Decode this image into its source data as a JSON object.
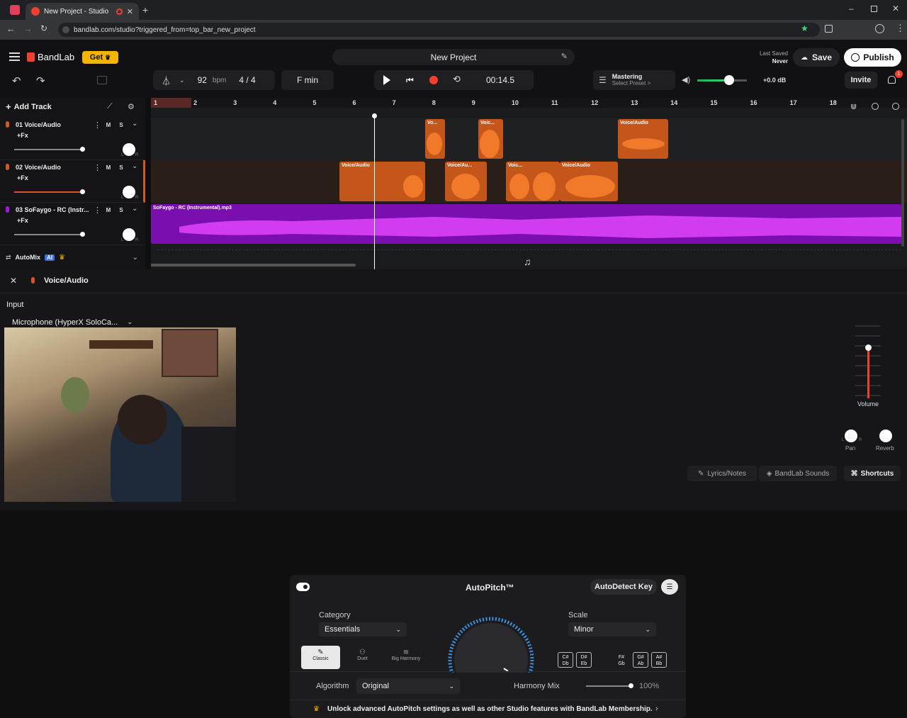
{
  "browser": {
    "tab_title": "New Project - Studio",
    "url": "bandlab.com/studio?triggered_from=top_bar_new_project"
  },
  "app": {
    "logo": "BandLab",
    "get_label": "Get",
    "project_title": "New Project",
    "last_saved_label": "Last Saved",
    "last_saved_value": "Never",
    "save_label": "Save",
    "publish_label": "Publish",
    "invite_label": "Invite",
    "notification_count": "1"
  },
  "transport": {
    "bpm": "92",
    "bpm_unit": "bpm",
    "time_sig": "4 / 4",
    "key": "F min",
    "time": "00:14.5",
    "mastering_label": "Mastering",
    "mastering_sub": "Select Preset >",
    "volume_db": "+0.0 dB"
  },
  "track_panel": {
    "add_track": "Add Track",
    "automix": "AutoMix",
    "ai_badge": "AI"
  },
  "tracks": [
    {
      "name": "01  Voice/Audio",
      "fx": "+Fx",
      "m": "M",
      "s": "S",
      "pan_l": "L",
      "pan_r": "R"
    },
    {
      "name": "02  Voice/Audio",
      "fx": "+Fx",
      "m": "M",
      "s": "S",
      "pan_l": "L",
      "pan_r": "R"
    },
    {
      "name": "03  SoFaygo - RC (Instr...",
      "fx": "+Fx",
      "m": "M",
      "s": "S",
      "pan_l": "L",
      "pan_r": "R"
    }
  ],
  "ruler": [
    "1",
    "2",
    "3",
    "4",
    "5",
    "6",
    "7",
    "8",
    "9",
    "10",
    "11",
    "12",
    "13",
    "14",
    "15",
    "16",
    "17",
    "18"
  ],
  "clips": {
    "c1a": "Vo...",
    "c1b": "Voic...",
    "c1c": "Voice/Audio",
    "c2a": "Voice/Audio",
    "c2b": "Voice/Au...",
    "c2c": "Voic...",
    "c2d": "Voice/Audio",
    "c3": "SoFaygo - RC (Instrumental).mp3"
  },
  "editor": {
    "title": "Voice/Audio",
    "input_label": "Input",
    "input_value": "Microphone (HyperX SoloCa...",
    "autopitch_title": "AutoPitch™",
    "autodetect": "AutoDetect Key",
    "category_label": "Category",
    "category_value": "Essentials",
    "scale_label": "Scale",
    "scale_value": "Minor",
    "presets": [
      "Classic",
      "Duet",
      "Big Harmony"
    ],
    "algorithm_label": "Algorithm",
    "algorithm_value": "Original",
    "harmony_label": "Harmony Mix",
    "harmony_value": "100%",
    "harmony_level": 1.0,
    "unlock": "Unlock advanced AutoPitch settings as well as other Studio features with BandLab Membership.",
    "keys": [
      [
        "C#",
        "Db"
      ],
      [
        "D#",
        "Eb"
      ],
      [
        "F#",
        "Gb"
      ],
      [
        "G#",
        "Ab"
      ],
      [
        "A#",
        "Bb"
      ]
    ],
    "volume_label": "Volume",
    "pan_label": "Pan",
    "reverb_label": "Reverb",
    "pan_l": "L",
    "pan_r": "R"
  },
  "footer": {
    "lyrics": "Lyrics/Notes",
    "sounds": "BandLab Sounds",
    "shortcuts": "Shortcuts"
  },
  "colors": {
    "accent": "#f2402f",
    "orange": "#c4551b",
    "purple": "#a416e8",
    "get": "#f5b400",
    "blue": "#3d8fe0"
  }
}
